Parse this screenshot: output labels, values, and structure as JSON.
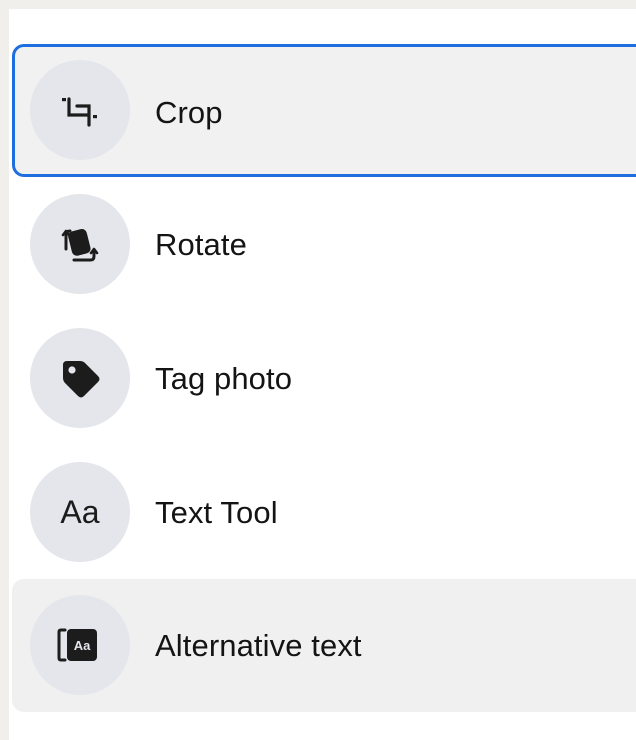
{
  "menu": {
    "items": [
      {
        "label": "Crop",
        "icon": "crop-icon",
        "state": "focused"
      },
      {
        "label": "Rotate",
        "icon": "rotate-icon"
      },
      {
        "label": "Tag photo",
        "icon": "tag-icon"
      },
      {
        "label": "Text Tool",
        "icon": "text-tool-icon",
        "glyph": "Aa"
      },
      {
        "label": "Alternative text",
        "icon": "alt-text-icon",
        "glyph": "Aa",
        "state": "hover"
      }
    ]
  },
  "colors": {
    "focus_ring": "#1e6ee0",
    "icon_circle": "#e4e6eb",
    "item_highlight": "#f0f0f0",
    "text": "#141414"
  }
}
